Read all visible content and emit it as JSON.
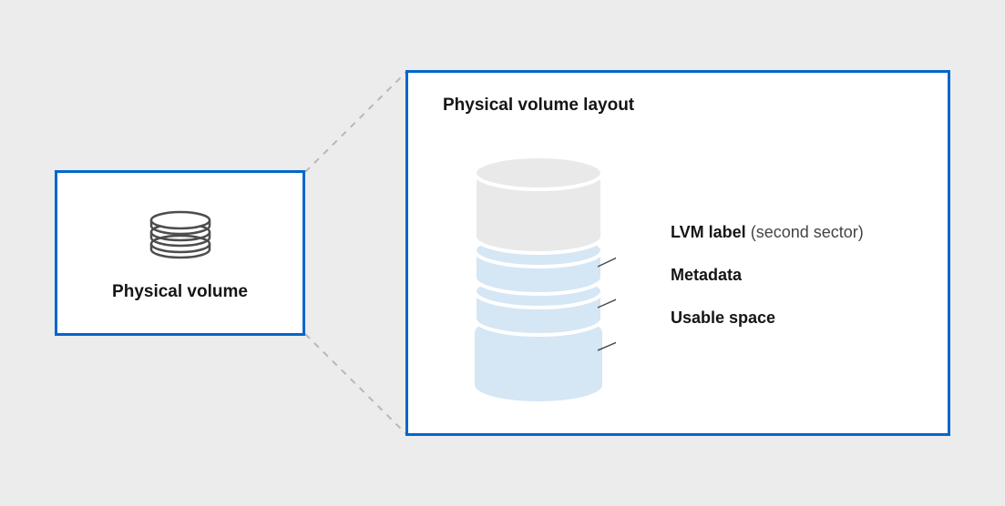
{
  "leftBox": {
    "label": "Physical volume"
  },
  "rightBox": {
    "title": "Physical volume layout",
    "layers": [
      {
        "label": "LVM label",
        "paren": "(second sector)"
      },
      {
        "label": "Metadata",
        "paren": ""
      },
      {
        "label": "Usable space",
        "paren": ""
      }
    ]
  }
}
